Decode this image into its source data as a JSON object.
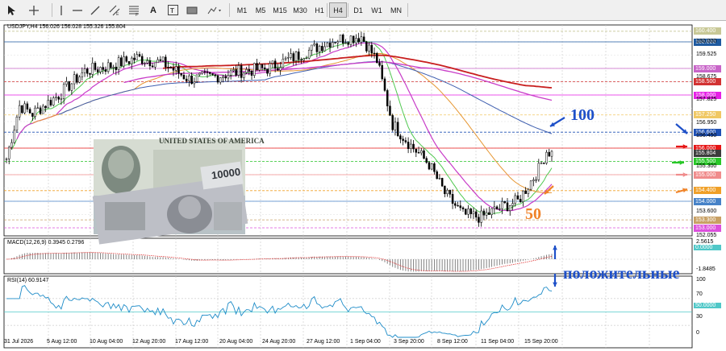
{
  "toolbar": {
    "timeframes": [
      "M1",
      "M5",
      "M15",
      "M30",
      "H1",
      "H4",
      "D1",
      "W1",
      "MN"
    ],
    "active_timeframe": "H4",
    "text_tool_label": "A"
  },
  "chart": {
    "header": "USDJPY,H4  156.026 156.028 155.326 155.804",
    "price_axis": [
      "160.000",
      "159.525",
      "158.675",
      "157.825",
      "156.950",
      "156.450",
      "155.300",
      "153.600",
      "152.055"
    ],
    "price_tags": [
      {
        "text": "160.400",
        "color": "#c8c896"
      },
      {
        "text": "160.000",
        "color": "#1e5aa0"
      },
      {
        "text": "159.000",
        "color": "#c864c8"
      },
      {
        "text": "158.500",
        "color": "#d23232"
      },
      {
        "text": "158.000",
        "color": "#e61ee6"
      },
      {
        "text": "157.250",
        "color": "#f0c864"
      },
      {
        "text": "156.600",
        "color": "#1e50b4"
      },
      {
        "text": "156.000",
        "color": "#e61414"
      },
      {
        "text": "155.804",
        "color": "#3c3c3c"
      },
      {
        "text": "155.500",
        "color": "#28c828"
      },
      {
        "text": "155.000",
        "color": "#f08c8c"
      },
      {
        "text": "154.400",
        "color": "#f0a028"
      },
      {
        "text": "154.000",
        "color": "#4682c8"
      },
      {
        "text": "153.300",
        "color": "#c8a064"
      },
      {
        "text": "153.000",
        "color": "#dc50dc"
      }
    ],
    "label_100": "100",
    "label_50": "50",
    "label_positive": "положительные"
  },
  "macd": {
    "header": "MACD(12,26,9) 0.3945 0.2796",
    "axis": [
      "2.5615",
      "0.0000",
      "-1.8485"
    ]
  },
  "rsi": {
    "header": "RSI(14) 60.9147",
    "axis": [
      "100",
      "70",
      "50.0000",
      "30",
      "0"
    ]
  },
  "time_axis": [
    "31 Jul 2026",
    "5 Aug 12:00",
    "10 Aug 04:00",
    "12 Aug 20:00",
    "17 Aug 12:00",
    "20 Aug 04:00",
    "24 Aug 20:00",
    "27 Aug 12:00",
    "1 Sep 04:00",
    "3 Sep 20:00",
    "8 Sep 12:00",
    "11 Sep 04:00",
    "15 Sep 20:00"
  ],
  "banknote": {
    "usd_text": "UNITED STATES OF AMERICA",
    "jpy_denomination": "10000"
  },
  "colors": {
    "ma100": "#4060b0",
    "ma200": "#c81e1e",
    "annotation_blue": "#1e50c8",
    "annotation_orange": "#f08228"
  }
}
